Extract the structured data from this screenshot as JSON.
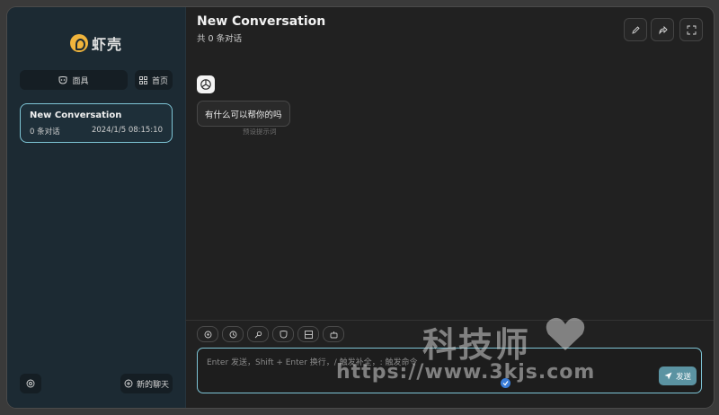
{
  "sidebar": {
    "logo_text": "虾壳",
    "mask_button_label": "面具",
    "home_button_label": "首页",
    "conversations": [
      {
        "title": "New Conversation",
        "count": "0 条对话",
        "time": "2024/1/5 08:15:10",
        "selected": true
      }
    ],
    "new_chat_label": "新的聊天"
  },
  "chat": {
    "title": "New Conversation",
    "subtitle": "共 0 条对话",
    "messages": [
      {
        "role": "assistant",
        "text": "有什么可以帮你的吗",
        "note": "预设提示词"
      }
    ],
    "input_placeholder": "Enter 发送，Shift + Enter 换行，/ 触发补全，: 触发命令",
    "send_label": "发送"
  },
  "watermark": {
    "cn": "科技师",
    "url": "https://www.3kjs.com"
  },
  "colors": {
    "accent": "#7ec5d6",
    "send_button": "#5b93a2",
    "sidebar_bg": "#1c2a33",
    "main_bg": "#212121"
  },
  "icons": [
    "mask-icon",
    "grid-icon",
    "settings-icon",
    "new-chat-icon",
    "edit-icon",
    "share-icon",
    "fullscreen-icon",
    "openai-icon",
    "send-icon"
  ]
}
